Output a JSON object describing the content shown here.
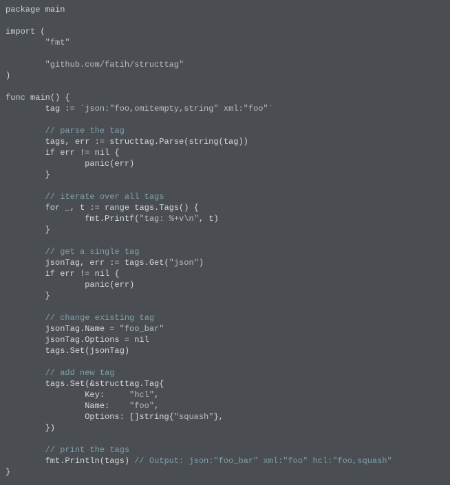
{
  "lines": [
    [
      {
        "cls": "kw",
        "t": "package"
      },
      {
        "cls": "id",
        "t": " main"
      }
    ],
    [
      {
        "cls": "id",
        "t": ""
      }
    ],
    [
      {
        "cls": "kw",
        "t": "import"
      },
      {
        "cls": "id",
        "t": " ("
      }
    ],
    [
      {
        "cls": "id",
        "t": "        "
      },
      {
        "cls": "str",
        "t": "\"fmt\""
      }
    ],
    [
      {
        "cls": "id",
        "t": ""
      }
    ],
    [
      {
        "cls": "id",
        "t": "        "
      },
      {
        "cls": "str",
        "t": "\"github.com/fatih/structtag\""
      }
    ],
    [
      {
        "cls": "id",
        "t": ")"
      }
    ],
    [
      {
        "cls": "id",
        "t": ""
      }
    ],
    [
      {
        "cls": "kw",
        "t": "func"
      },
      {
        "cls": "id",
        "t": " main() {"
      }
    ],
    [
      {
        "cls": "id",
        "t": "        tag := "
      },
      {
        "cls": "str",
        "t": "`json:\"foo,omitempty,string\" xml:\"foo\"`"
      }
    ],
    [
      {
        "cls": "id",
        "t": ""
      }
    ],
    [
      {
        "cls": "id",
        "t": "        "
      },
      {
        "cls": "cm",
        "t": "// parse the tag"
      }
    ],
    [
      {
        "cls": "id",
        "t": "        tags, err := structtag.Parse(string(tag))"
      }
    ],
    [
      {
        "cls": "id",
        "t": "        "
      },
      {
        "cls": "kw",
        "t": "if"
      },
      {
        "cls": "id",
        "t": " err != nil {"
      }
    ],
    [
      {
        "cls": "id",
        "t": "                panic(err)"
      }
    ],
    [
      {
        "cls": "id",
        "t": "        }"
      }
    ],
    [
      {
        "cls": "id",
        "t": ""
      }
    ],
    [
      {
        "cls": "id",
        "t": "        "
      },
      {
        "cls": "cm",
        "t": "// iterate over all tags"
      }
    ],
    [
      {
        "cls": "id",
        "t": "        "
      },
      {
        "cls": "kw",
        "t": "for"
      },
      {
        "cls": "id",
        "t": " _, t := "
      },
      {
        "cls": "kw",
        "t": "range"
      },
      {
        "cls": "id",
        "t": " tags.Tags() {"
      }
    ],
    [
      {
        "cls": "id",
        "t": "                fmt.Printf("
      },
      {
        "cls": "str",
        "t": "\"tag: %+v\\n\""
      },
      {
        "cls": "id",
        "t": ", t)"
      }
    ],
    [
      {
        "cls": "id",
        "t": "        }"
      }
    ],
    [
      {
        "cls": "id",
        "t": ""
      }
    ],
    [
      {
        "cls": "id",
        "t": "        "
      },
      {
        "cls": "cm",
        "t": "// get a single tag"
      }
    ],
    [
      {
        "cls": "id",
        "t": "        jsonTag, err := tags.Get("
      },
      {
        "cls": "str",
        "t": "\"json\""
      },
      {
        "cls": "id",
        "t": ")"
      }
    ],
    [
      {
        "cls": "id",
        "t": "        "
      },
      {
        "cls": "kw",
        "t": "if"
      },
      {
        "cls": "id",
        "t": " err != nil {"
      }
    ],
    [
      {
        "cls": "id",
        "t": "                panic(err)"
      }
    ],
    [
      {
        "cls": "id",
        "t": "        }"
      }
    ],
    [
      {
        "cls": "id",
        "t": ""
      }
    ],
    [
      {
        "cls": "id",
        "t": "        "
      },
      {
        "cls": "cm",
        "t": "// change existing tag"
      }
    ],
    [
      {
        "cls": "id",
        "t": "        jsonTag.Name = "
      },
      {
        "cls": "str",
        "t": "\"foo_bar\""
      }
    ],
    [
      {
        "cls": "id",
        "t": "        jsonTag.Options = nil"
      }
    ],
    [
      {
        "cls": "id",
        "t": "        tags.Set(jsonTag)"
      }
    ],
    [
      {
        "cls": "id",
        "t": ""
      }
    ],
    [
      {
        "cls": "id",
        "t": "        "
      },
      {
        "cls": "cm",
        "t": "// add new tag"
      }
    ],
    [
      {
        "cls": "id",
        "t": "        tags.Set(&structtag.Tag{"
      }
    ],
    [
      {
        "cls": "id",
        "t": "                Key:     "
      },
      {
        "cls": "str",
        "t": "\"hcl\""
      },
      {
        "cls": "id",
        "t": ","
      }
    ],
    [
      {
        "cls": "id",
        "t": "                Name:    "
      },
      {
        "cls": "str",
        "t": "\"foo\""
      },
      {
        "cls": "id",
        "t": ","
      }
    ],
    [
      {
        "cls": "id",
        "t": "                Options: []string{"
      },
      {
        "cls": "str",
        "t": "\"squash\""
      },
      {
        "cls": "id",
        "t": "},"
      }
    ],
    [
      {
        "cls": "id",
        "t": "        })"
      }
    ],
    [
      {
        "cls": "id",
        "t": ""
      }
    ],
    [
      {
        "cls": "id",
        "t": "        "
      },
      {
        "cls": "cm",
        "t": "// print the tags"
      }
    ],
    [
      {
        "cls": "id",
        "t": "        fmt.Println(tags) "
      },
      {
        "cls": "cm",
        "t": "// Output: json:\"foo_bar\" xml:\"foo\" hcl:\"foo,squash\""
      }
    ],
    [
      {
        "cls": "id",
        "t": "}"
      }
    ]
  ]
}
